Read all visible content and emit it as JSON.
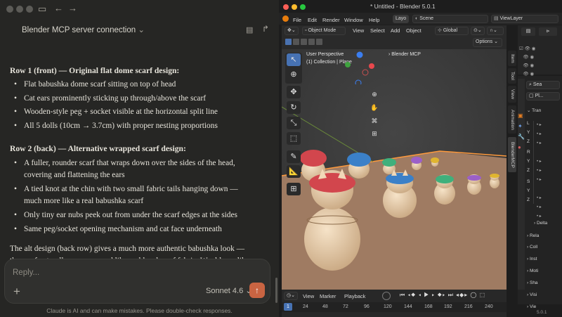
{
  "chat": {
    "title": "Blender MCP server connection",
    "row1_heading": "Row 1 (front) — Original flat dome scarf design:",
    "row1_items": [
      "Flat babushka dome scarf sitting on top of head",
      "Cat ears prominently sticking up through/above the scarf",
      "Wooden-style peg + socket visible at the horizontal split line",
      "All 5 dolls (10cm → 3.7cm) with proper nesting proportions"
    ],
    "row2_heading": "Row 2 (back) — Alternative wrapped scarf design:",
    "row2_items": [
      "A fuller, rounder scarf that wraps down over the sides of the head, covering and flattening the ears",
      "A tied knot at the chin with two small fabric tails hanging down — much more like a real babushka scarf",
      "Only tiny ear nubs peek out from under the scarf edges at the sides",
      "Same peg/socket opening mechanism and cat face underneath"
    ],
    "closing": "The alt design (back row) gives a much more authentic babushka look — the scarf naturally wraps around like real head scarf fabric. Would you like to",
    "reply_placeholder": "Reply...",
    "model": "Sonnet 4.6",
    "disclaimer": "Claude is AI and can make mistakes. Please double-check responses."
  },
  "blender": {
    "window_title": "* Untitled - Blender 5.0.1",
    "menus": [
      "File",
      "Edit",
      "Render",
      "Window",
      "Help"
    ],
    "layout_tab": "Layo",
    "scene": "Scene",
    "view_layer": "ViewLayer",
    "mode": "Object Mode",
    "header_menus": [
      "View",
      "Select",
      "Add",
      "Object"
    ],
    "transform_orientation": "Global",
    "options": "Options",
    "overlay_line1": "User Perspective",
    "overlay_line2": "(1) Collection | Plane",
    "panel": "Blender MCP",
    "side_tabs": [
      "Item",
      "Tool",
      "View",
      "Animation",
      "BlenderMCP"
    ],
    "props": {
      "search": "Sea",
      "object": "Pl...",
      "transform": "Tran",
      "axes": [
        "L",
        "Y",
        "Z",
        "R",
        "Y",
        "Z",
        "S",
        "Y",
        "Z"
      ],
      "delta": "Delta",
      "sections": [
        "Rela",
        "Coll",
        "Inst",
        "Moti",
        "Sha",
        "Visi",
        "Vie"
      ]
    },
    "timeline": {
      "menus": [
        "View",
        "Marker",
        "Playback"
      ],
      "current_frame": "1",
      "frames": [
        "24",
        "48",
        "72",
        "96",
        "120",
        "144",
        "168",
        "192",
        "216",
        "240"
      ]
    },
    "version": "5.0.1",
    "colors": {
      "accent": "#c96442",
      "selection": "#ff9a3c"
    }
  }
}
